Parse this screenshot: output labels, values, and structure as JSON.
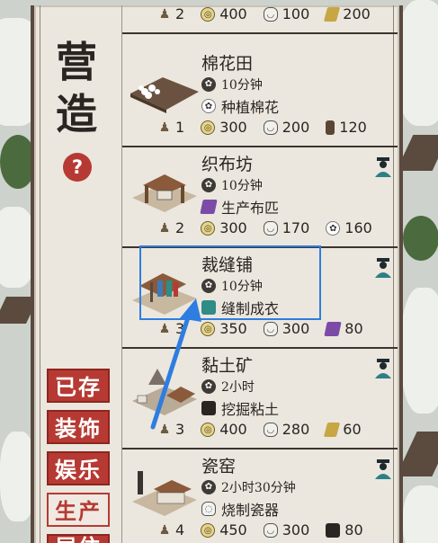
{
  "sidebar": {
    "title_line1": "营",
    "title_line2": "造",
    "help_label": "?",
    "tabs": [
      {
        "label": "已存",
        "active": false
      },
      {
        "label": "装饰",
        "active": false
      },
      {
        "label": "娱乐",
        "active": false
      },
      {
        "label": "生产",
        "active": true
      },
      {
        "label": "居住",
        "active": false
      }
    ]
  },
  "top_cut_costs": {
    "c1": "2",
    "c2": "400",
    "c3": "100",
    "c4": "200"
  },
  "buildings": [
    {
      "name": "棉花田",
      "time": "10分钟",
      "product": "种植棉花",
      "product_icon": "cotton-icon",
      "has_worker": false,
      "costs": [
        {
          "icon": "person-icon",
          "value": "1"
        },
        {
          "icon": "coin-icon",
          "value": "300"
        },
        {
          "icon": "bowl-icon",
          "value": "200"
        },
        {
          "icon": "wood-icon",
          "value": "120"
        }
      ]
    },
    {
      "name": "织布坊",
      "time": "10分钟",
      "product": "生产布匹",
      "product_icon": "cloth-icon",
      "has_worker": true,
      "costs": [
        {
          "icon": "person-icon",
          "value": "2"
        },
        {
          "icon": "coin-icon",
          "value": "300"
        },
        {
          "icon": "bowl-icon",
          "value": "170"
        },
        {
          "icon": "cotton-icon",
          "value": "160"
        }
      ]
    },
    {
      "name": "裁缝铺",
      "time": "10分钟",
      "product": "缝制成衣",
      "product_icon": "robe-icon",
      "has_worker": true,
      "costs": [
        {
          "icon": "person-icon",
          "value": "3"
        },
        {
          "icon": "coin-icon",
          "value": "350"
        },
        {
          "icon": "bowl-icon",
          "value": "300"
        },
        {
          "icon": "cloth-icon",
          "value": "80"
        }
      ]
    },
    {
      "name": "黏土矿",
      "time": "2小时",
      "product": "挖掘粘土",
      "product_icon": "clay-icon",
      "has_worker": true,
      "costs": [
        {
          "icon": "person-icon",
          "value": "3"
        },
        {
          "icon": "coin-icon",
          "value": "400"
        },
        {
          "icon": "bowl-icon",
          "value": "280"
        },
        {
          "icon": "brick-icon",
          "value": "60"
        }
      ]
    },
    {
      "name": "瓷窑",
      "time": "2小时30分钟",
      "product": "烧制瓷器",
      "product_icon": "vase-icon",
      "has_worker": true,
      "costs": [
        {
          "icon": "person-icon",
          "value": "4"
        },
        {
          "icon": "coin-icon",
          "value": "450"
        },
        {
          "icon": "bowl-icon",
          "value": "300"
        },
        {
          "icon": "clay-icon",
          "value": "80"
        }
      ]
    }
  ],
  "colors": {
    "accent_red": "#b63a33",
    "highlight_blue": "#2e7de0",
    "panel_bg": "#ebe7de"
  }
}
